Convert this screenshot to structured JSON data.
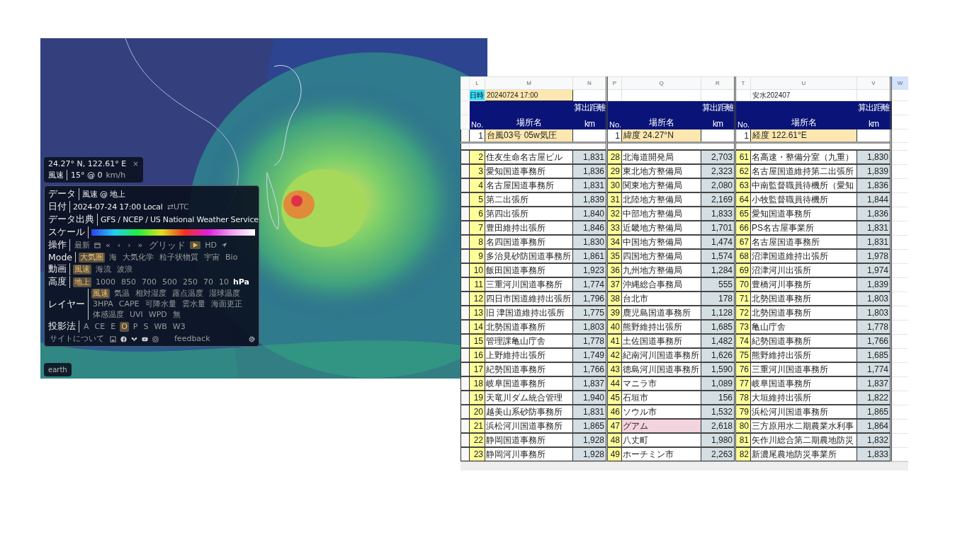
{
  "earth": {
    "location": {
      "coordinates": "24.27° N, 122.61° E",
      "close": "×",
      "label": "風速",
      "value": "15° @ 0",
      "unit": "km/h"
    },
    "menu": {
      "rows": [
        {
          "kind": "text",
          "label": "データ",
          "value": "風速 @ 地上"
        },
        {
          "kind": "text",
          "label": "日付",
          "value": "2024-07-24 17:00 Local",
          "toggle": "⇄UTC"
        },
        {
          "kind": "text",
          "label": "データ出典",
          "value": "GFS / NCEP / US National Weather Service"
        },
        {
          "kind": "scale",
          "label": "スケール"
        },
        {
          "kind": "controls",
          "label": "操作",
          "latest": "最新",
          "steps": [
            "«",
            "‹",
            "›",
            "»"
          ],
          "grid": "グリッド",
          "playing": true,
          "hd": "HD"
        },
        {
          "kind": "options",
          "label": "Mode",
          "options": [
            {
              "text": "大気圏",
              "selected": true
            },
            {
              "text": "海",
              "selected": false
            },
            {
              "text": "大気化学",
              "selected": false
            },
            {
              "text": "粒子状物質",
              "selected": false
            },
            {
              "text": "宇宙",
              "selected": false
            },
            {
              "text": "Bio",
              "selected": false
            }
          ]
        },
        {
          "kind": "options",
          "label": "動画",
          "options": [
            {
              "text": "風速",
              "selected": true
            },
            {
              "text": "海流",
              "selected": false
            },
            {
              "text": "波浪",
              "selected": false
            }
          ]
        },
        {
          "kind": "options",
          "label": "高度",
          "unit": "hPa",
          "options": [
            {
              "text": "地上",
              "selected": true
            },
            {
              "text": "1000",
              "selected": false
            },
            {
              "text": "850",
              "selected": false
            },
            {
              "text": "700",
              "selected": false
            },
            {
              "text": "500",
              "selected": false
            },
            {
              "text": "250",
              "selected": false
            },
            {
              "text": "70",
              "selected": false
            },
            {
              "text": "10",
              "selected": false
            }
          ]
        },
        {
          "kind": "options",
          "label": "レイヤー",
          "options": [
            {
              "text": "風速",
              "selected": true
            },
            {
              "text": "気温",
              "selected": false
            },
            {
              "text": "相対湿度",
              "selected": false
            },
            {
              "text": "露点温度",
              "selected": false
            },
            {
              "text": "湿球温度",
              "selected": false
            },
            {
              "text": "3HPA",
              "selected": false
            },
            {
              "text": "CAPE",
              "selected": false
            },
            {
              "text": "可降水量",
              "selected": false
            },
            {
              "text": "雲水量",
              "selected": false
            },
            {
              "text": "海面更正",
              "selected": false
            },
            {
              "text": "体感温度",
              "selected": false
            },
            {
              "text": "UVI",
              "selected": false
            },
            {
              "text": "WPD",
              "selected": false
            },
            {
              "text": "無",
              "selected": false
            }
          ]
        },
        {
          "kind": "options",
          "label": "投影法",
          "options": [
            {
              "text": "A",
              "selected": false
            },
            {
              "text": "CE",
              "selected": false
            },
            {
              "text": "E",
              "selected": false
            },
            {
              "text": "O",
              "selected": true
            },
            {
              "text": "P",
              "selected": false
            },
            {
              "text": "S",
              "selected": false
            },
            {
              "text": "WB",
              "selected": false
            },
            {
              "text": "W3",
              "selected": false
            }
          ]
        }
      ],
      "footer": {
        "about": "サイトについて",
        "feedback": "feedback"
      }
    },
    "earth_button": "earth"
  },
  "sheet": {
    "columns": [
      "L",
      "M",
      "N",
      "P",
      "Q",
      "R",
      "T",
      "U",
      "V",
      "W"
    ],
    "date_label": "日時",
    "date": "20240724 17:00",
    "note": "安水202407",
    "groups": [
      {
        "no": "No.",
        "name": "場所名",
        "distance": "算出距離",
        "unit": "km",
        "origin": {
          "no": "1",
          "name": "台風03号 05w気圧"
        },
        "rows": [
          {
            "no": "2",
            "name": "住友生命名古屋ビル",
            "km": "1,831"
          },
          {
            "no": "3",
            "name": "愛知国道事務所",
            "km": "1,836"
          },
          {
            "no": "4",
            "name": "名古屋国道事務所",
            "km": "1,831"
          },
          {
            "no": "5",
            "name": "第二出張所",
            "km": "1,839"
          },
          {
            "no": "6",
            "name": "第四出張所",
            "km": "1,840"
          },
          {
            "no": "7",
            "name": "豊田維持出張所",
            "km": "1,846"
          },
          {
            "no": "8",
            "name": "名四国道事務所",
            "km": "1,830"
          },
          {
            "no": "9",
            "name": "多治見砂防国道事務所",
            "km": "1,861"
          },
          {
            "no": "10",
            "name": "飯田国道事務所",
            "km": "1,923"
          },
          {
            "no": "11",
            "name": "三重河川国道事務所",
            "km": "1,774"
          },
          {
            "no": "12",
            "name": "四日市国道維持出張所",
            "km": "1,796"
          },
          {
            "no": "13",
            "name": "旧 津国道維持出張所",
            "km": "1,775"
          },
          {
            "no": "14",
            "name": "北勢国道事務所",
            "km": "1,803"
          },
          {
            "no": "15",
            "name": "管理課亀山庁舎",
            "km": "1,778"
          },
          {
            "no": "16",
            "name": "上野維持出張所",
            "km": "1,749"
          },
          {
            "no": "17",
            "name": "紀勢国道事務所",
            "km": "1,766"
          },
          {
            "no": "18",
            "name": "岐阜国道事務所",
            "km": "1,837"
          },
          {
            "no": "19",
            "name": "天竜川ダム統合管理",
            "km": "1,940"
          },
          {
            "no": "20",
            "name": "越美山系砂防事務所",
            "km": "1,831"
          },
          {
            "no": "21",
            "name": "浜松河川国道事務所",
            "km": "1,865"
          },
          {
            "no": "22",
            "name": "静岡国道事務所",
            "km": "1,928"
          },
          {
            "no": "23",
            "name": "静岡河川事務所",
            "km": "1,928"
          }
        ]
      },
      {
        "no": "No.",
        "name": "場所名",
        "distance": "算出距離",
        "unit": "km",
        "origin": {
          "no": "1",
          "name": "緯度 24.27°N"
        },
        "rows": [
          {
            "no": "28",
            "name": "北海道開発局",
            "km": "2,703"
          },
          {
            "no": "29",
            "name": "東北地方整備局",
            "km": "2,323"
          },
          {
            "no": "30",
            "name": "関東地方整備局",
            "km": "2,080"
          },
          {
            "no": "31",
            "name": "北陸地方整備局",
            "km": "2,169"
          },
          {
            "no": "32",
            "name": "中部地方整備局",
            "km": "1,833"
          },
          {
            "no": "33",
            "name": "近畿地方整備局",
            "km": "1,701"
          },
          {
            "no": "34",
            "name": "中国地方整備局",
            "km": "1,474"
          },
          {
            "no": "35",
            "name": "四国地方整備局",
            "km": "1,574"
          },
          {
            "no": "36",
            "name": "九州地方整備局",
            "km": "1,284"
          },
          {
            "no": "37",
            "name": "沖縄総合事務局",
            "km": "555"
          },
          {
            "no": "38",
            "name": "台北市",
            "km": "178"
          },
          {
            "no": "39",
            "name": "鹿児島国道事務所",
            "km": "1,128"
          },
          {
            "no": "40",
            "name": "熊野維持出張所",
            "km": "1,685"
          },
          {
            "no": "41",
            "name": "土佐国道事務所",
            "km": "1,482"
          },
          {
            "no": "42",
            "name": "紀南河川国道事務所",
            "km": "1,626"
          },
          {
            "no": "43",
            "name": "徳島河川国道事務所",
            "km": "1,590"
          },
          {
            "no": "44",
            "name": "マニラ市",
            "km": "1,089"
          },
          {
            "no": "45",
            "name": "石垣市",
            "km": "156"
          },
          {
            "no": "46",
            "name": "ソウル市",
            "km": "1,532"
          },
          {
            "no": "47",
            "name": "グアム",
            "km": "2,618",
            "highlighted": true
          },
          {
            "no": "48",
            "name": "八丈町",
            "km": "1,980"
          },
          {
            "no": "49",
            "name": "ホーチミン市",
            "km": "2,263"
          }
        ]
      },
      {
        "no": "No.",
        "name": "場所名",
        "distance": "算出距離",
        "unit": "km",
        "origin": {
          "no": "1",
          "name": "経度 122.61°E"
        },
        "rows": [
          {
            "no": "61",
            "name": "名高速・整備分室（九重）",
            "km": "1,830"
          },
          {
            "no": "62",
            "name": "名古屋国道維持第二出張所",
            "km": "1,839"
          },
          {
            "no": "63",
            "name": "中南監督職員待機所（愛知",
            "km": "1,836"
          },
          {
            "no": "64",
            "name": "小牧監督職員待機所",
            "km": "1,844"
          },
          {
            "no": "65",
            "name": "愛知国道事務所",
            "km": "1,836"
          },
          {
            "no": "66",
            "name": "PS名古屋事業所",
            "km": "1,831"
          },
          {
            "no": "67",
            "name": "名古屋国道事務所",
            "km": "1,831"
          },
          {
            "no": "68",
            "name": "沼津国道維持出張所",
            "km": "1,978"
          },
          {
            "no": "69",
            "name": "沼津河川出張所",
            "km": "1,974"
          },
          {
            "no": "70",
            "name": "豊橋河川事務所",
            "km": "1,839"
          },
          {
            "no": "71",
            "name": "北勢国道事務所",
            "km": "1,803"
          },
          {
            "no": "72",
            "name": "北勢国道事務所",
            "km": "1,803"
          },
          {
            "no": "73",
            "name": "亀山庁舎",
            "km": "1,778"
          },
          {
            "no": "74",
            "name": "紀勢国道事務所",
            "km": "1,766"
          },
          {
            "no": "75",
            "name": "熊野維持出張所",
            "km": "1,685"
          },
          {
            "no": "76",
            "name": "三重河川国道事務所",
            "km": "1,774"
          },
          {
            "no": "77",
            "name": "岐阜国道事務所",
            "km": "1,837"
          },
          {
            "no": "78",
            "name": "大垣維持出張所",
            "km": "1,822"
          },
          {
            "no": "79",
            "name": "浜松河川国道事務所",
            "km": "1,865"
          },
          {
            "no": "80",
            "name": "三方原用水二期農業水利事",
            "km": "1,864"
          },
          {
            "no": "81",
            "name": "矢作川総合第二期農地防災",
            "km": "1,832"
          },
          {
            "no": "82",
            "name": "新濃尾農地防災事業所",
            "km": "1,833"
          }
        ]
      }
    ]
  }
}
